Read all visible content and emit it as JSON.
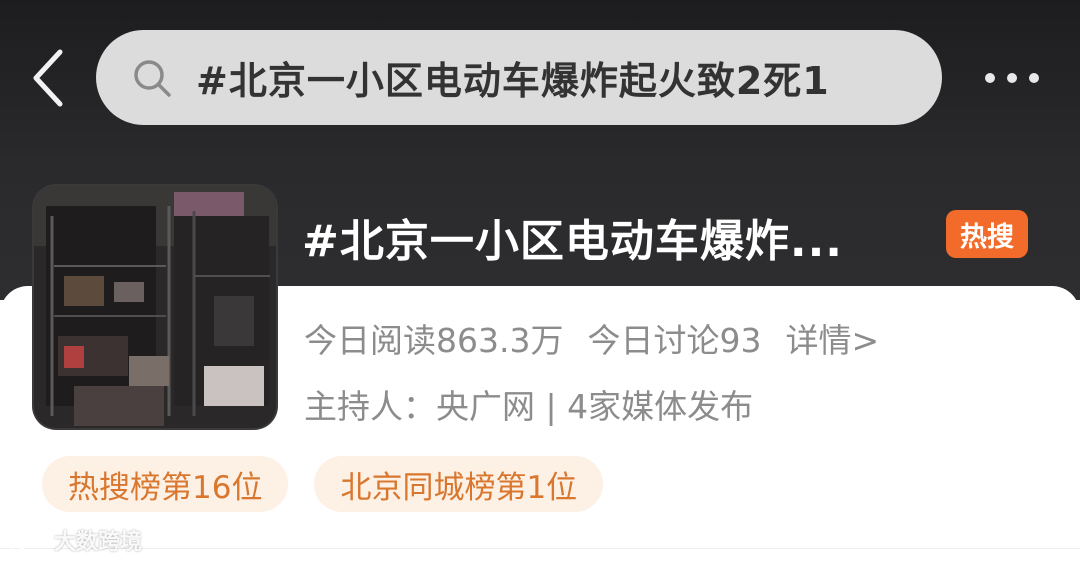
{
  "header": {
    "search_text": "#北京一小区电动车爆炸起火致2死1",
    "back_icon": "chevron-left-icon",
    "search_icon": "search-icon",
    "more_icon": "more-horizontal-icon"
  },
  "topic": {
    "title": "#北京一小区电动车爆炸...",
    "badge": "热搜",
    "badge_color": "#f26b2a"
  },
  "stats": {
    "reads": "今日阅读863.3万",
    "discussions": "今日讨论93",
    "detail_link": "详情>"
  },
  "host": {
    "line": "主持人：央广网 | 4家媒体发布"
  },
  "tags": [
    {
      "label": "热搜榜第16位"
    },
    {
      "label": "北京同城榜第1位"
    }
  ],
  "watermark": {
    "text": "大数跨境"
  },
  "colors": {
    "header_bg": "#1d1d1f",
    "tag_bg": "#fdf0e4",
    "tag_text": "#d9772f",
    "meta_text": "#8c8c8c"
  }
}
